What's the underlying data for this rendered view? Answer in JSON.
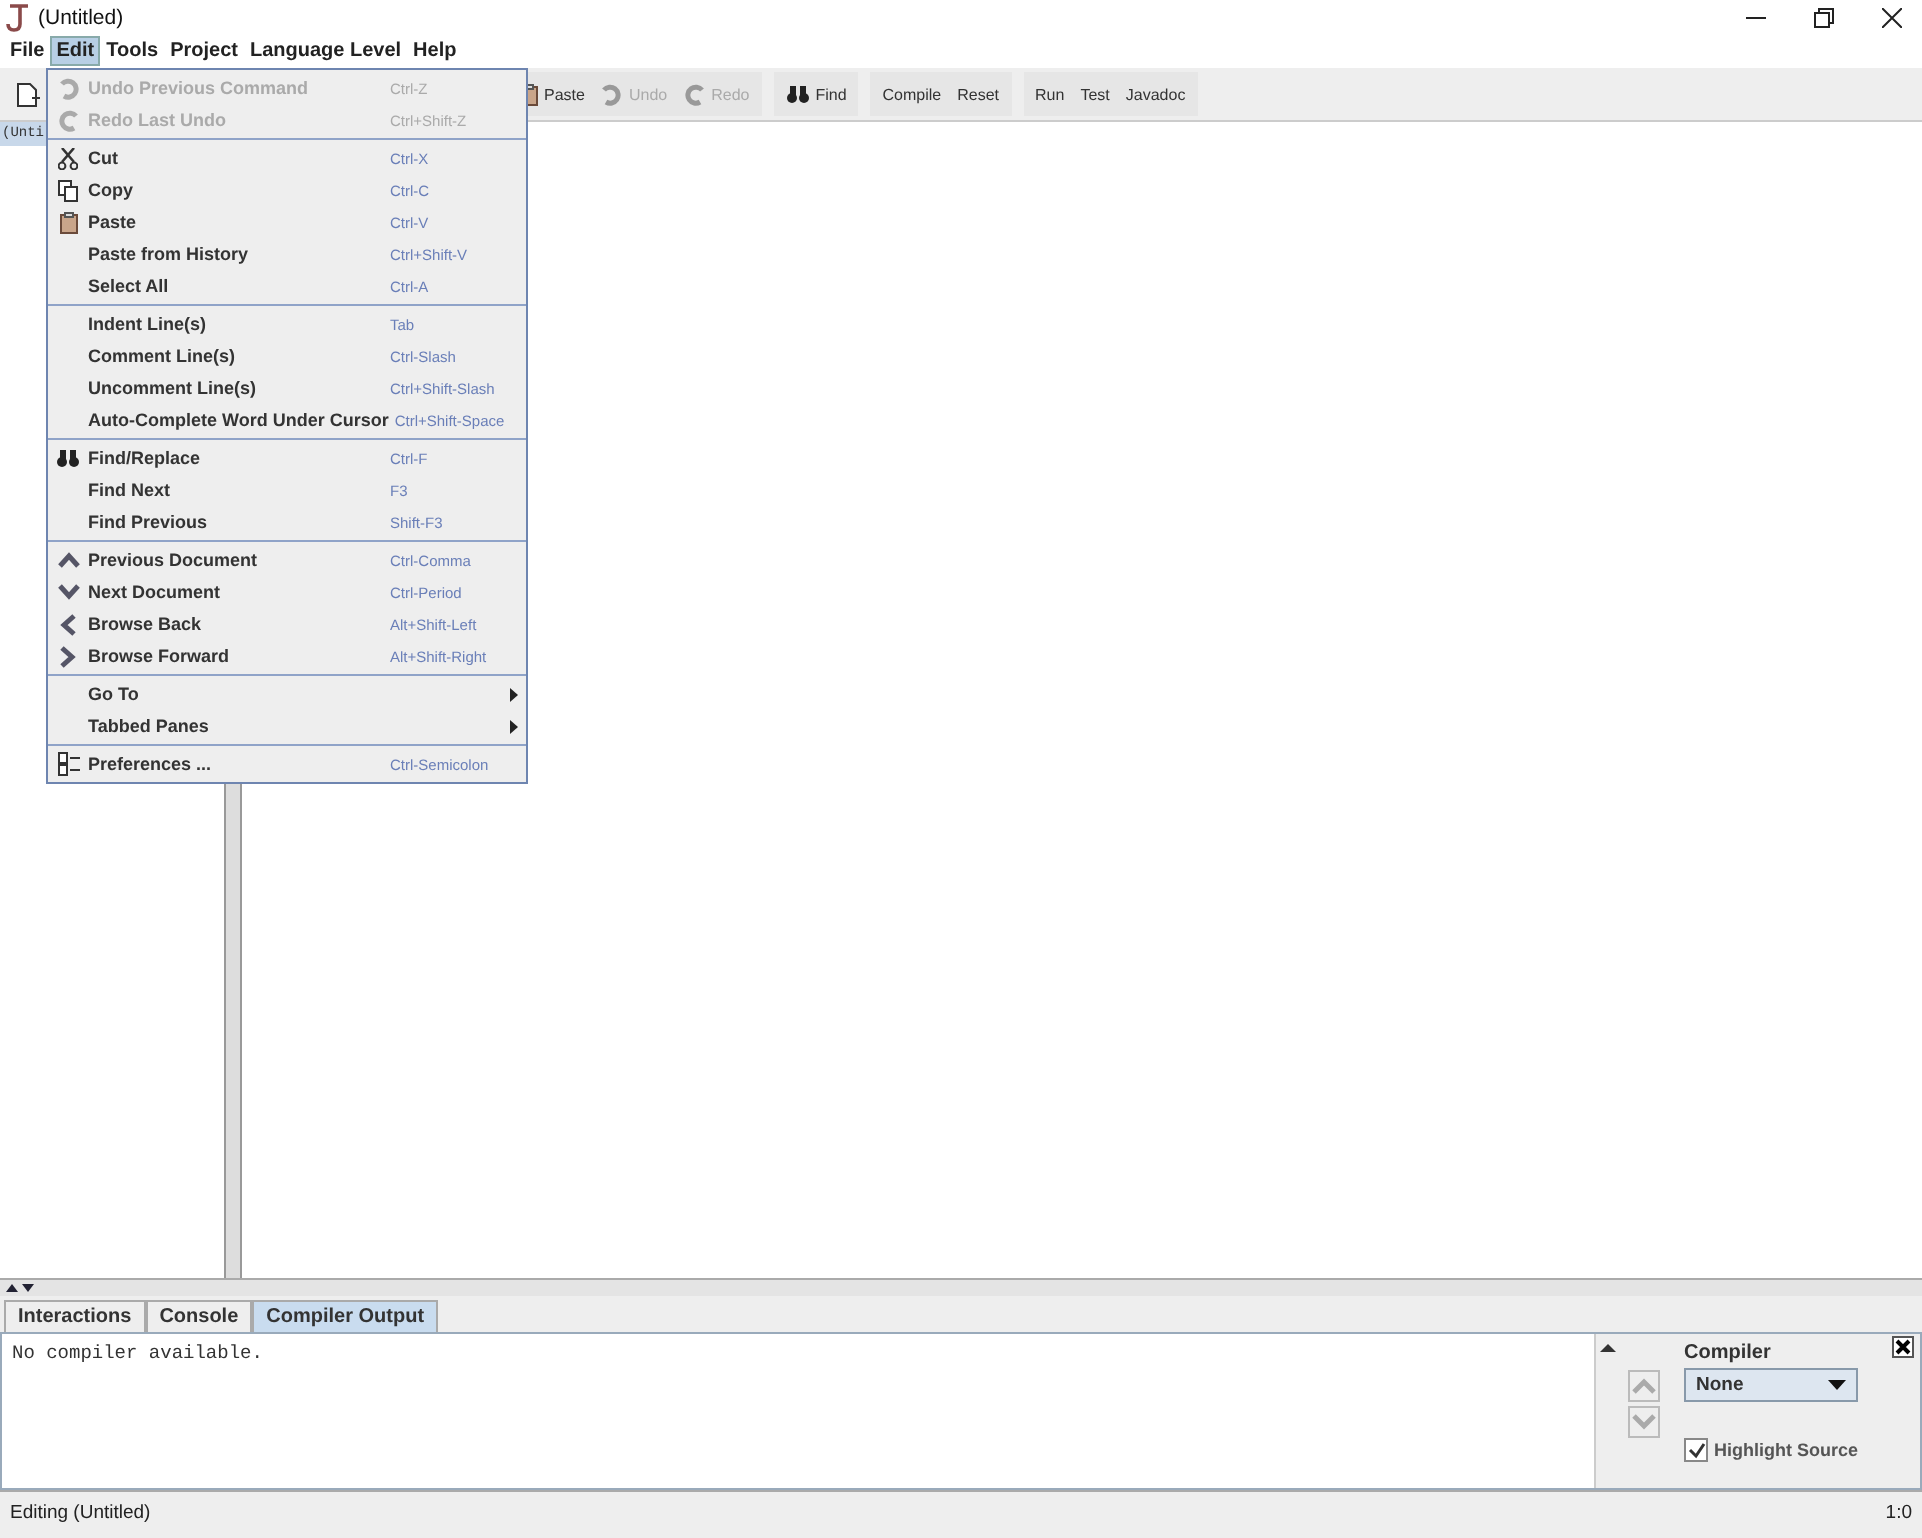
{
  "window": {
    "title": "(Untitled)"
  },
  "menubar": [
    {
      "label": "File",
      "selected": false
    },
    {
      "label": "Edit",
      "selected": true
    },
    {
      "label": "Tools",
      "selected": false
    },
    {
      "label": "Project",
      "selected": false
    },
    {
      "label": "Language Level",
      "selected": false
    },
    {
      "label": "Help",
      "selected": false
    }
  ],
  "edit_menu": [
    [
      {
        "kind": "item",
        "label": "Undo Previous Command",
        "shortcut": "Ctrl-Z",
        "disabled": true
      },
      {
        "kind": "item",
        "label": "Redo Last Undo",
        "shortcut": "Ctrl+Shift-Z",
        "disabled": true
      }
    ],
    [
      {
        "kind": "item",
        "label": "Cut",
        "shortcut": "Ctrl-X",
        "disabled": false
      },
      {
        "kind": "item",
        "label": "Copy",
        "shortcut": "Ctrl-C",
        "disabled": false
      },
      {
        "kind": "item",
        "label": "Paste",
        "shortcut": "Ctrl-V",
        "disabled": false
      },
      {
        "kind": "item",
        "label": "Paste from History",
        "shortcut": "Ctrl+Shift-V",
        "disabled": false
      },
      {
        "kind": "item",
        "label": "Select All",
        "shortcut": "Ctrl-A",
        "disabled": false
      }
    ],
    [
      {
        "kind": "item",
        "label": "Indent Line(s)",
        "shortcut": "Tab",
        "disabled": false
      },
      {
        "kind": "item",
        "label": "Comment Line(s)",
        "shortcut": "Ctrl-Slash",
        "disabled": false
      },
      {
        "kind": "item",
        "label": "Uncomment Line(s)",
        "shortcut": "Ctrl+Shift-Slash",
        "disabled": false
      },
      {
        "kind": "item",
        "label": "Auto-Complete Word Under Cursor",
        "shortcut": "Ctrl+Shift-Space",
        "disabled": false
      }
    ],
    [
      {
        "kind": "item",
        "label": "Find/Replace",
        "shortcut": "Ctrl-F",
        "disabled": false
      },
      {
        "kind": "item",
        "label": "Find Next",
        "shortcut": "F3",
        "disabled": false
      },
      {
        "kind": "item",
        "label": "Find Previous",
        "shortcut": "Shift-F3",
        "disabled": false
      }
    ],
    [
      {
        "kind": "item",
        "label": "Previous Document",
        "shortcut": "Ctrl-Comma",
        "disabled": false
      },
      {
        "kind": "item",
        "label": "Next Document",
        "shortcut": "Ctrl-Period",
        "disabled": false
      },
      {
        "kind": "item",
        "label": "Browse Back",
        "shortcut": "Alt+Shift-Left",
        "disabled": false
      },
      {
        "kind": "item",
        "label": "Browse Forward",
        "shortcut": "Alt+Shift-Right",
        "disabled": false
      }
    ],
    [
      {
        "kind": "submenu",
        "label": "Go To"
      },
      {
        "kind": "submenu",
        "label": "Tabbed Panes"
      }
    ],
    [
      {
        "kind": "item",
        "label": "Preferences ...",
        "shortcut": "Ctrl-Semicolon",
        "disabled": false
      }
    ]
  ],
  "toolbar": [
    [
      {
        "label": "Paste",
        "disabled": false
      },
      {
        "label": "Undo",
        "disabled": true
      },
      {
        "label": "Redo",
        "disabled": true
      }
    ],
    [
      {
        "label": "Find",
        "disabled": false
      }
    ],
    [
      {
        "label": "Compile",
        "disabled": false
      },
      {
        "label": "Reset",
        "disabled": false
      }
    ],
    [
      {
        "label": "Run",
        "disabled": false
      },
      {
        "label": "Test",
        "disabled": false
      },
      {
        "label": "Javadoc",
        "disabled": false
      }
    ]
  ],
  "documents": [
    {
      "label": "(Unti",
      "selected": true
    }
  ],
  "bottom_tabs": [
    {
      "label": "Interactions",
      "selected": false
    },
    {
      "label": "Console",
      "selected": false
    },
    {
      "label": "Compiler Output",
      "selected": true
    }
  ],
  "output": "No compiler available.",
  "compiler_panel": {
    "label": "Compiler",
    "value": "None",
    "highlight": {
      "label": "Highlight Source",
      "checked": true
    }
  },
  "status_bar": {
    "text": "Editing (Untitled)",
    "position": "1:0"
  }
}
